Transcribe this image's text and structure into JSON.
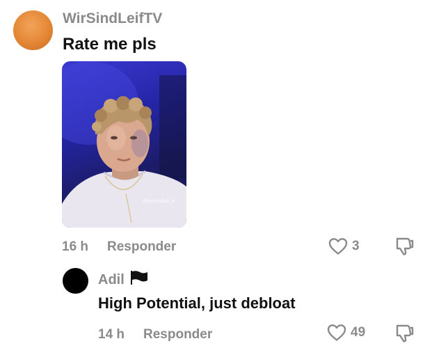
{
  "comment": {
    "username": "WirSindLeifTV",
    "text": "Rate me pls",
    "photo_watermark": "@wirsindleif_tv",
    "time": "16 h",
    "reply_label": "Responder",
    "like_count": "3",
    "avatar_color": "#e38735"
  },
  "reply": {
    "username": "Adil",
    "flag_icon": "black-flag-icon",
    "text": "High Potential, just debloat",
    "time": "14 h",
    "reply_label": "Responder",
    "like_count": "49",
    "avatar_color": "#000000"
  },
  "icons": {
    "like": "heart-outline-icon",
    "dislike": "thumbs-down-outline-icon"
  }
}
